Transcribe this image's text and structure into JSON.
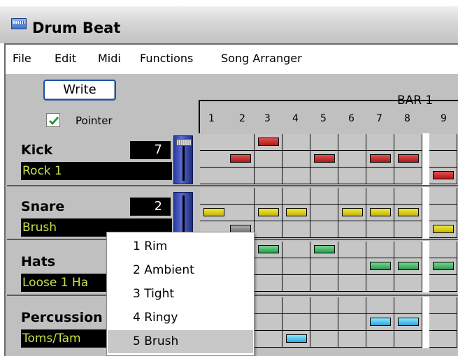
{
  "window": {
    "title": "Drum Beat"
  },
  "menu": {
    "items": [
      "File",
      "Edit",
      "Midi",
      "Functions",
      "Song Arranger"
    ]
  },
  "controls": {
    "write_label": "Write",
    "pointer_label": "Pointer",
    "pointer_checked": true
  },
  "grid": {
    "bar_label": "BAR 1",
    "beats": [
      "1",
      "2",
      "3",
      "4",
      "5",
      "6",
      "7",
      "8",
      "9"
    ]
  },
  "tracks": [
    {
      "name": "Kick",
      "value": "7",
      "style": "Rock 1"
    },
    {
      "name": "Snare",
      "value": "2",
      "style": "Brush"
    },
    {
      "name": "Hats",
      "value": "",
      "style": "Loose 1 Ha"
    },
    {
      "name": "Percussion",
      "value": "",
      "style": "Toms/Tam"
    }
  ],
  "notes": [
    {
      "row": 0,
      "col": 2,
      "color": "red"
    },
    {
      "row": 1,
      "col": 1,
      "color": "red"
    },
    {
      "row": 1,
      "col": 4,
      "color": "red"
    },
    {
      "row": 1,
      "col": 6,
      "color": "red"
    },
    {
      "row": 1,
      "col": 7,
      "color": "red"
    },
    {
      "row": 2,
      "col": 8,
      "color": "red"
    },
    {
      "row": 4,
      "col": 0,
      "color": "yellow"
    },
    {
      "row": 4,
      "col": 2,
      "color": "yellow"
    },
    {
      "row": 4,
      "col": 3,
      "color": "yellow"
    },
    {
      "row": 4,
      "col": 5,
      "color": "yellow"
    },
    {
      "row": 4,
      "col": 6,
      "color": "yellow"
    },
    {
      "row": 4,
      "col": 7,
      "color": "yellow"
    },
    {
      "row": 5,
      "col": 1,
      "color": "gray"
    },
    {
      "row": 5,
      "col": 8,
      "color": "yellow"
    },
    {
      "row": 6,
      "col": 2,
      "color": "green"
    },
    {
      "row": 6,
      "col": 4,
      "color": "green"
    },
    {
      "row": 7,
      "col": 6,
      "color": "green"
    },
    {
      "row": 7,
      "col": 7,
      "color": "green"
    },
    {
      "row": 7,
      "col": 8,
      "color": "green"
    },
    {
      "row": 10,
      "col": 6,
      "color": "cyan"
    },
    {
      "row": 10,
      "col": 7,
      "color": "cyan"
    },
    {
      "row": 11,
      "col": 3,
      "color": "cyan"
    }
  ],
  "context_menu": {
    "items": [
      "1  Rim",
      "2  Ambient",
      "3  Tight",
      "4  Ringy",
      "5  Brush"
    ],
    "selected_index": 4
  },
  "colors": {
    "red": "#d02828",
    "yellow": "#e0d020",
    "green": "#3ab860",
    "cyan": "#40b8e8",
    "style_text": "#c8e04a"
  }
}
